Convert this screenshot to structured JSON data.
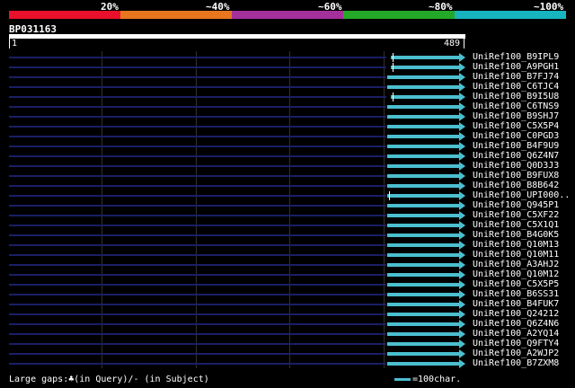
{
  "identity_scale": {
    "labels": [
      "20%",
      "~40%",
      "~60%",
      "~80%",
      "~100%"
    ],
    "colors": [
      "#e8102a",
      "#e8761f",
      "#a4309a",
      "#24a828",
      "#17b4bf"
    ]
  },
  "query": {
    "id": "BP031163",
    "start_label": "1",
    "end_label": "489"
  },
  "hits": [
    {
      "name": "UniRef100_B9IPL9",
      "start": 0.836,
      "gap": true
    },
    {
      "name": "UniRef100_A9PGH1",
      "start": 0.836,
      "gap": true
    },
    {
      "name": "UniRef100_B7FJ74",
      "start": 0.828,
      "gap": false
    },
    {
      "name": "UniRef100_C6TJC4",
      "start": 0.828,
      "gap": false
    },
    {
      "name": "UniRef100_B9I5U8",
      "start": 0.836,
      "gap": true
    },
    {
      "name": "UniRef100_C6TNS9",
      "start": 0.828,
      "gap": false
    },
    {
      "name": "UniRef100_B9SHJ7",
      "start": 0.828,
      "gap": false
    },
    {
      "name": "UniRef100_C5X5P4",
      "start": 0.828,
      "gap": false
    },
    {
      "name": "UniRef100_C0PGD3",
      "start": 0.828,
      "gap": false
    },
    {
      "name": "UniRef100_B4F9U9",
      "start": 0.828,
      "gap": false
    },
    {
      "name": "UniRef100_Q6Z4N7",
      "start": 0.828,
      "gap": false
    },
    {
      "name": "UniRef100_Q0D3J3",
      "start": 0.828,
      "gap": false
    },
    {
      "name": "UniRef100_B9FUX8",
      "start": 0.828,
      "gap": false
    },
    {
      "name": "UniRef100_B8B642",
      "start": 0.828,
      "gap": false
    },
    {
      "name": "UniRef100_UPI000..",
      "start": 0.828,
      "gap": true
    },
    {
      "name": "UniRef100_Q945P1",
      "start": 0.828,
      "gap": false
    },
    {
      "name": "UniRef100_C5XF22",
      "start": 0.828,
      "gap": false
    },
    {
      "name": "UniRef100_C5X1Q1",
      "start": 0.828,
      "gap": false
    },
    {
      "name": "UniRef100_B4G0K5",
      "start": 0.828,
      "gap": false
    },
    {
      "name": "UniRef100_Q10M13",
      "start": 0.828,
      "gap": false
    },
    {
      "name": "UniRef100_Q10M11",
      "start": 0.828,
      "gap": false
    },
    {
      "name": "UniRef100_A3AHJ2",
      "start": 0.828,
      "gap": false
    },
    {
      "name": "UniRef100_Q10M12",
      "start": 0.828,
      "gap": false
    },
    {
      "name": "UniRef100_C5X5P5",
      "start": 0.828,
      "gap": false
    },
    {
      "name": "UniRef100_B6SS31",
      "start": 0.828,
      "gap": false
    },
    {
      "name": "UniRef100_B4FUK7",
      "start": 0.828,
      "gap": false
    },
    {
      "name": "UniRef100_Q24212",
      "start": 0.828,
      "gap": false
    },
    {
      "name": "UniRef100_Q6Z4N6",
      "start": 0.828,
      "gap": false
    },
    {
      "name": "UniRef100_A2YQ14",
      "start": 0.828,
      "gap": false
    },
    {
      "name": "UniRef100_Q9FTY4",
      "start": 0.828,
      "gap": false
    },
    {
      "name": "UniRef100_A2WJP2",
      "start": 0.828,
      "gap": false
    },
    {
      "name": "UniRef100_B7ZXM8",
      "start": 0.828,
      "gap": false
    }
  ],
  "footer": {
    "text": "Large gaps:♣(in Query)/- (in Subject)"
  },
  "legend": {
    "text": "=100char."
  }
}
